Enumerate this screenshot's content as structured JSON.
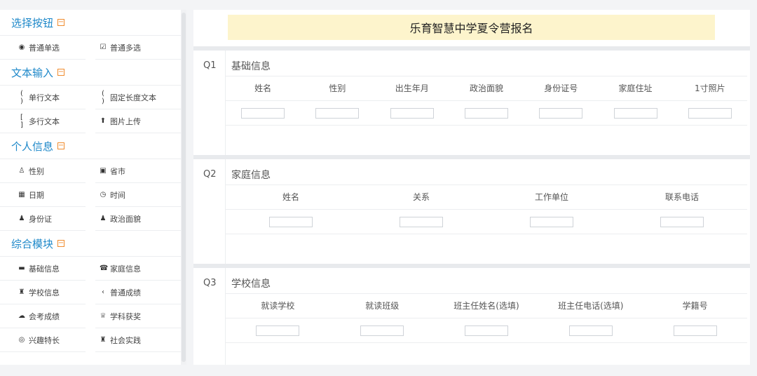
{
  "sidebar": {
    "groups": [
      {
        "title": "选择按钮",
        "toggle": "−",
        "items": [
          {
            "icon": "◉",
            "label": "普通单选"
          },
          {
            "icon": "☑",
            "label": "普通多选"
          }
        ]
      },
      {
        "title": "文本输入",
        "toggle": "−",
        "items": [
          {
            "icon": "( )",
            "label": "单行文本"
          },
          {
            "icon": "( )",
            "label": "固定长度文本"
          },
          {
            "icon": "[ ]",
            "label": "多行文本"
          },
          {
            "icon": "⬆",
            "label": "图片上传"
          }
        ]
      },
      {
        "title": "个人信息",
        "toggle": "−",
        "items": [
          {
            "icon": "♙",
            "label": "性别"
          },
          {
            "icon": "▣",
            "label": "省市"
          },
          {
            "icon": "▦",
            "label": "日期"
          },
          {
            "icon": "◷",
            "label": "时间"
          },
          {
            "icon": "♟",
            "label": "身份证"
          },
          {
            "icon": "♟",
            "label": "政治面貌"
          }
        ]
      },
      {
        "title": "综合模块",
        "toggle": "−",
        "items": [
          {
            "icon": "▬",
            "label": "基础信息"
          },
          {
            "icon": "☎",
            "label": "家庭信息"
          },
          {
            "icon": "♜",
            "label": "学校信息"
          },
          {
            "icon": "‹",
            "label": "普通成绩"
          },
          {
            "icon": "☁",
            "label": "会考成绩"
          },
          {
            "icon": "♕",
            "label": "学科获奖"
          },
          {
            "icon": "◎",
            "label": "兴趣特长"
          },
          {
            "icon": "♜",
            "label": "社会实践"
          }
        ]
      }
    ]
  },
  "main": {
    "banner": "乐育智慧中学夏令营报名",
    "sections": [
      {
        "q": "Q1",
        "title": "基础信息",
        "columns": [
          "姓名",
          "性别",
          "出生年月",
          "政治面貌",
          "身份证号",
          "家庭住址",
          "1寸照片"
        ]
      },
      {
        "q": "Q2",
        "title": "家庭信息",
        "columns": [
          "姓名",
          "关系",
          "工作单位",
          "联系电话"
        ]
      },
      {
        "q": "Q3",
        "title": "学校信息",
        "columns": [
          "就读学校",
          "就读班级",
          "班主任姓名(选填)",
          "班主任电话(选填)",
          "学籍号"
        ]
      }
    ]
  }
}
